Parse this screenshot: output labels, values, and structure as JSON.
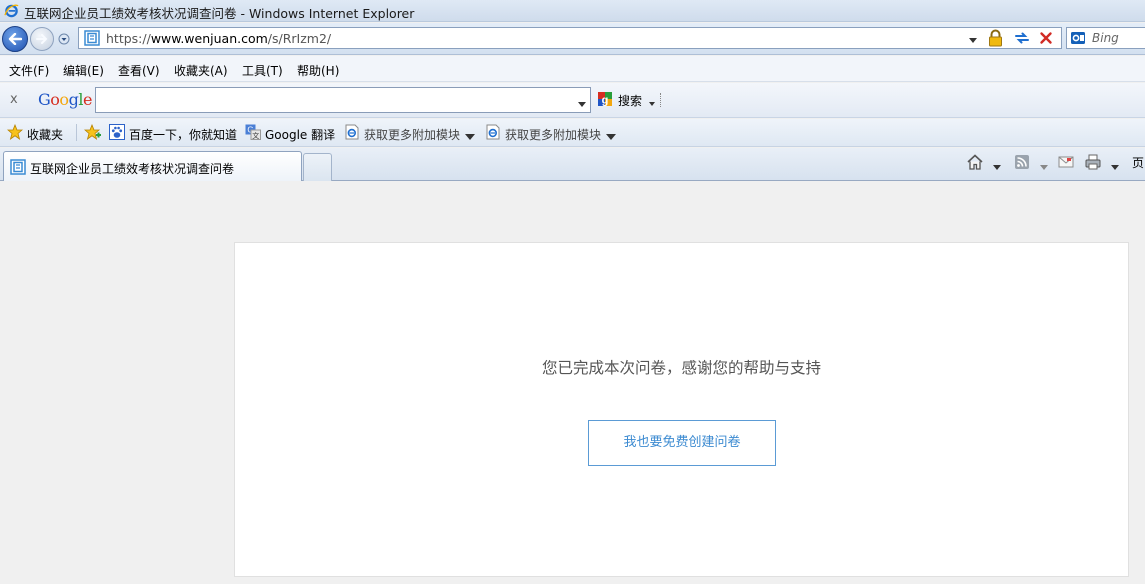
{
  "window": {
    "title": "互联网企业员工绩效考核状况调查问卷 - Windows Internet Explorer"
  },
  "address_bar": {
    "url_scheme": "https://",
    "url_host": "www.wenjuan.com",
    "url_path": "/s/RrIzm2/"
  },
  "search": {
    "placeholder": "Bing"
  },
  "menu": {
    "items": [
      "文件(F)",
      "编辑(E)",
      "查看(V)",
      "收藏夹(A)",
      "工具(T)",
      "帮助(H)"
    ]
  },
  "google_toolbar": {
    "close": "x",
    "logo_letters": [
      "G",
      "o",
      "o",
      "g",
      "l",
      "e"
    ],
    "logo_colors": [
      "#1f55c6",
      "#d62d20",
      "#f3a70f",
      "#1f55c6",
      "#2a9d3a",
      "#d62d20"
    ],
    "search_label": "搜索"
  },
  "favorites_bar": {
    "favorites_label": "收藏夹",
    "items": [
      "百度一下，你就知道",
      "Google 翻译",
      "获取更多附加模块",
      "获取更多附加模块"
    ]
  },
  "tabs": [
    {
      "label": "互联网企业员工绩效考核状况调查问卷"
    }
  ],
  "command_bar": {
    "page_label": "页"
  },
  "content": {
    "thanks_message": "您已完成本次问卷，感谢您的帮助与支持",
    "create_button": "我也要免费创建问卷"
  },
  "colors": {
    "accent": "#3d8bd1",
    "button_border": "#5b9bd5"
  }
}
